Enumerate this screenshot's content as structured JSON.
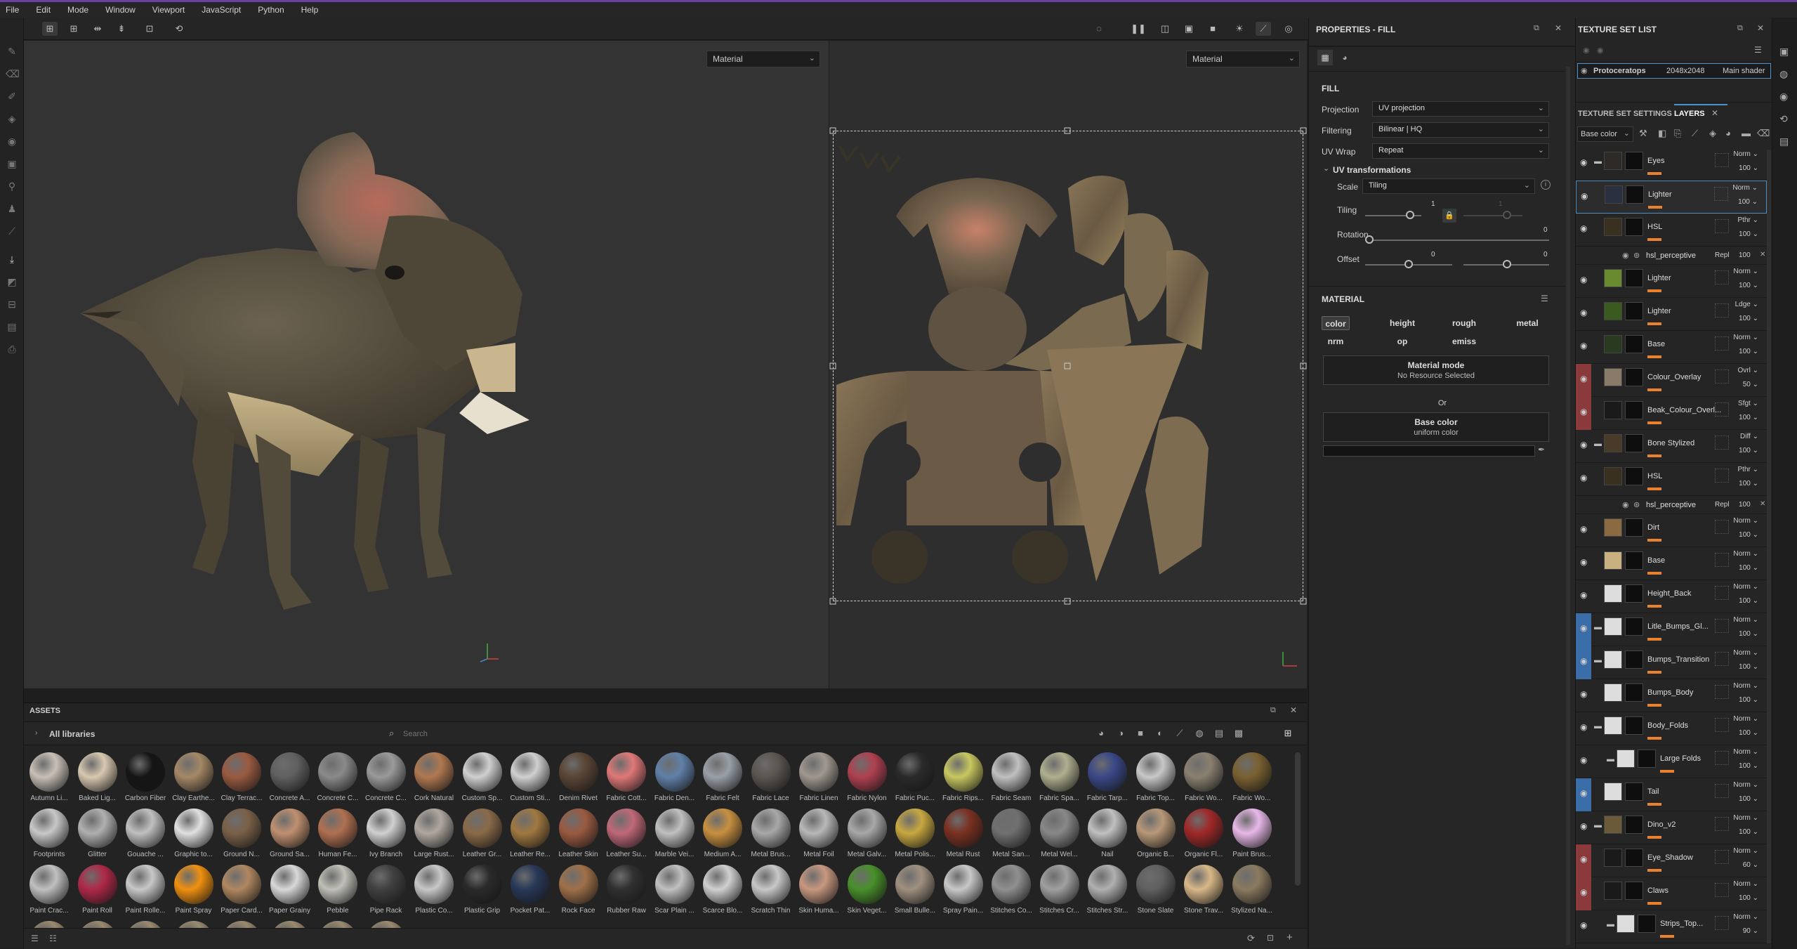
{
  "menu": [
    "File",
    "Edit",
    "Mode",
    "Window",
    "Viewport",
    "JavaScript",
    "Python",
    "Help"
  ],
  "viewport": {
    "left_dropdown": "Material",
    "right_dropdown": "Material"
  },
  "properties": {
    "title": "PROPERTIES - FILL",
    "section": "FILL",
    "projection_label": "Projection",
    "projection": "UV projection",
    "filtering_label": "Filtering",
    "filtering": "Bilinear | HQ",
    "uvwrap_label": "UV Wrap",
    "uvwrap": "Repeat",
    "uvtrans": "UV transformations",
    "scale_label": "Scale",
    "scale": "Tiling",
    "tiling_label": "Tiling",
    "tiling_val": "1",
    "tiling_val2": "1",
    "rotation_label": "Rotation",
    "rotation_val": "0",
    "offset_label": "Offset",
    "offset_val1": "0",
    "offset_val2": "0",
    "material_header": "MATERIAL",
    "channels": [
      "color",
      "height",
      "rough",
      "metal",
      "nrm",
      "op",
      "emiss"
    ],
    "matmode_title": "Material mode",
    "matmode_sub": "No Resource Selected",
    "or": "Or",
    "basecolor_title": "Base color",
    "basecolor_sub": "uniform color"
  },
  "textureset": {
    "title": "TEXTURE SET LIST",
    "name": "Protoceratops",
    "size": "2048x2048",
    "shader": "Main shader",
    "tab_settings": "TEXTURE SET SETTINGS",
    "tab_layers": "LAYERS",
    "channel": "Base color"
  },
  "layers": [
    {
      "name": "Eyes",
      "blend": "Norm",
      "opacity": "100"
    },
    {
      "name": "Lighter",
      "blend": "Norm",
      "opacity": "100"
    },
    {
      "name": "HSL",
      "blend": "Pthr",
      "opacity": "100"
    },
    {
      "name": "hsl_perceptive",
      "blend": "Repl",
      "opacity": "100"
    },
    {
      "name": "Lighter",
      "blend": "Norm",
      "opacity": "100"
    },
    {
      "name": "Lighter",
      "blend": "Ldge",
      "opacity": "100"
    },
    {
      "name": "Base",
      "blend": "Norm",
      "opacity": "100"
    },
    {
      "name": "Colour_Overlay",
      "blend": "Ovrl",
      "opacity": "50"
    },
    {
      "name": "Beak_Colour_Overl...",
      "blend": "Sfgt",
      "opacity": "100"
    },
    {
      "name": "Bone Stylized",
      "blend": "Diff",
      "opacity": "100"
    },
    {
      "name": "HSL",
      "blend": "Pthr",
      "opacity": "100"
    },
    {
      "name": "hsl_perceptive",
      "blend": "Repl",
      "opacity": "100"
    },
    {
      "name": "Dirt",
      "blend": "Norm",
      "opacity": "100"
    },
    {
      "name": "Base",
      "blend": "Norm",
      "opacity": "100"
    },
    {
      "name": "Height_Back",
      "blend": "Norm",
      "opacity": "100"
    },
    {
      "name": "Litle_Bumps_Gl...",
      "blend": "Norm",
      "opacity": "100"
    },
    {
      "name": "Bumps_Transition",
      "blend": "Norm",
      "opacity": "100"
    },
    {
      "name": "Bumps_Body",
      "blend": "Norm",
      "opacity": "100"
    },
    {
      "name": "Body_Folds",
      "blend": "Norm",
      "opacity": "100"
    },
    {
      "name": "Large Folds",
      "blend": "Norm",
      "opacity": "100"
    },
    {
      "name": "Tail",
      "blend": "Norm",
      "opacity": "100"
    },
    {
      "name": "Dino_v2",
      "blend": "Norm",
      "opacity": "100"
    },
    {
      "name": "Eye_Shadow",
      "blend": "Norm",
      "opacity": "60"
    },
    {
      "name": "Claws",
      "blend": "Norm",
      "opacity": "100"
    },
    {
      "name": "Strips_Top...",
      "blend": "Norm",
      "opacity": "90"
    }
  ],
  "assets": {
    "title": "ASSETS",
    "library": "All libraries",
    "search_placeholder": "Search",
    "row1": [
      "Autumn Li...",
      "Baked Lig...",
      "Carbon Fiber",
      "Clay Earthe...",
      "Clay Terrac...",
      "Concrete A...",
      "Concrete C...",
      "Concrete C...",
      "Cork Natural",
      "Custom Sp...",
      "Custom Sti...",
      "Denim Rivet",
      "Fabric Cott...",
      "Fabric Den...",
      "Fabric Felt",
      "Fabric Lace",
      "Fabric Linen",
      "Fabric Nylon",
      "Fabric Puc...",
      "Fabric Rips...",
      "Fabric Seam",
      "Fabric Spa...",
      "Fabric Tarp...",
      "Fabric Top...",
      "Fabric Wo...",
      "Fabric Wo..."
    ],
    "row2": [
      "Footprints",
      "Glitter",
      "Gouache ...",
      "Graphic to...",
      "Ground N...",
      "Ground Sa...",
      "Human Fe...",
      "Ivy Branch",
      "Large Rust...",
      "Leather Gr...",
      "Leather Re...",
      "Leather Skin",
      "Leather Su...",
      "Marble Vei...",
      "Medium A...",
      "Metal Brus...",
      "Metal Foil",
      "Metal Galv...",
      "Metal Polis...",
      "Metal Rust",
      "Metal San...",
      "Metal Wel...",
      "Nail",
      "Organic B...",
      "Organic Fl...",
      "Paint Brus..."
    ],
    "row3": [
      "Paint Crac...",
      "Paint Roll",
      "Paint Rolle...",
      "Paint Spray",
      "Paper Card...",
      "Paper Grainy",
      "Pebble",
      "Pipe Rack",
      "Plastic Co...",
      "Plastic Grip",
      "Pocket Pat...",
      "Rock Face",
      "Rubber Raw",
      "Scar Plain ...",
      "Scarce Blo...",
      "Scratch Thin",
      "Skin Huma...",
      "Skin Veget...",
      "Small Bulle...",
      "Spray Pain...",
      "Stitches Co...",
      "Stitches Cr...",
      "Stitches Str...",
      "Stone Slate",
      "Stone Trav...",
      "Stylized Na..."
    ],
    "colors1": [
      "#c8c0b8",
      "#d8c8b0",
      "#151515",
      "#a58866",
      "#9a5a40",
      "#606060",
      "#8a8a8a",
      "#9a9a9a",
      "#b07850",
      "#d0d0d0",
      "#d0d0d0",
      "#5a4535",
      "#e07878",
      "#6080a8",
      "#9aa0a8",
      "#5a5650",
      "#a09890",
      "#b04050",
      "#2a2a2a",
      "#c8c860",
      "#c0c0c0",
      "#b0b090",
      "#3a4888",
      "#c8c8c8",
      "#8a8070",
      "#7a6030"
    ],
    "colors2": [
      "#c8c8c8",
      "#b0b0b0",
      "#c0c0c0",
      "#e0e0e0",
      "#7a6048",
      "#c09070",
      "#b07050",
      "#d0d0d0",
      "#b0a8a0",
      "#8a6a48",
      "#a07840",
      "#9a5a40",
      "#c06878",
      "#c0c0c0",
      "#c89040",
      "#a8a8a8",
      "#b8b8b8",
      "#a8a8a8",
      "#c8a840",
      "#7a3020",
      "#707070",
      "#888888",
      "#c0c0c0",
      "#b89878",
      "#a02828",
      "#e8b8e8"
    ],
    "colors3": [
      "#c0c0c0",
      "#b02848",
      "#c8c8c8",
      "#f09010",
      "#b08860",
      "#d8d8d8",
      "#c0c0b8",
      "#404040",
      "#c8c8c8",
      "#2a2a2a",
      "#283858",
      "#a07048",
      "#303030",
      "#c0c0c0",
      "#d0d0d0",
      "#c8c8c8",
      "#c89880",
      "#48902a",
      "#a09080",
      "#c8c8c8",
      "#909090",
      "#a0a0a0",
      "#b0b0b0",
      "#606060",
      "#d8b888",
      "#8a7a60"
    ],
    "accent": "#e8822e"
  }
}
